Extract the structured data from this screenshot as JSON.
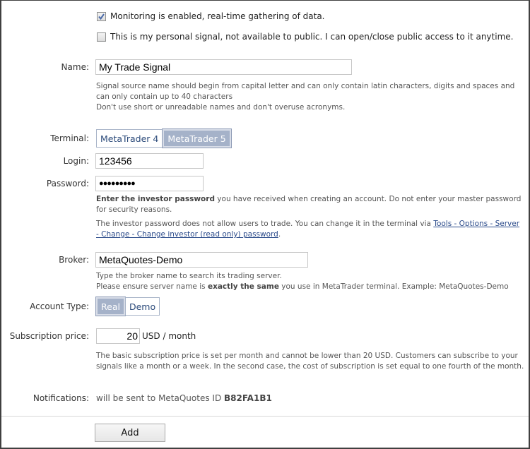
{
  "checkboxes": [
    {
      "label": "Monitoring is enabled, real-time gathering of data.",
      "checked": true
    },
    {
      "label": "This is my personal signal, not available to public. I can open/close public access to it anytime.",
      "checked": false
    }
  ],
  "name": {
    "label": "Name:",
    "value": "My Trade Signal",
    "hint_line1": "Signal source name should begin from capital letter and can only contain latin characters, digits and spaces and can only contain up to 40 characters",
    "hint_line2": "Don't use short or unreadable names and don't overuse acronyms."
  },
  "terminal": {
    "label": "Terminal:",
    "options": [
      "MetaTrader 4",
      "MetaTrader 5"
    ],
    "selected": "MetaTrader 5"
  },
  "login": {
    "label": "Login:",
    "value": "123456"
  },
  "password": {
    "label": "Password:",
    "masked_value": "●●●●●●●●●",
    "hint_bold": "Enter the investor password",
    "hint_rest": " you have received when creating an account. Do not enter your master password for security reasons.",
    "hint2_prefix": "The investor password does not allow users to trade. You can change it in the terminal via ",
    "hint2_link": "Tools - Options - Server - Change - Change investor (read only) password",
    "hint2_suffix": "."
  },
  "broker": {
    "label": "Broker:",
    "value": "MetaQuotes-Demo",
    "hint_line1": "Type the broker name to search its trading server.",
    "hint_line2_prefix": "Please ensure server name is ",
    "hint_line2_bold": "exactly the same",
    "hint_line2_suffix": " you use in MetaTrader terminal. Example: MetaQuotes-Demo"
  },
  "account_type": {
    "label": "Account Type:",
    "options": [
      "Real",
      "Demo"
    ],
    "selected": "Real"
  },
  "subscription": {
    "label": "Subscription price:",
    "value": "20",
    "unit": "USD / month",
    "hint": "The basic subscription price is set per month and cannot be lower than 20 USD. Customers can subscribe to your signals like a month or a week. In the second case, the cost of subscription is set equal to one fourth of the month."
  },
  "notifications": {
    "label": "Notifications:",
    "text": "will be sent to MetaQuotes ID ",
    "id": "B82FA1B1"
  },
  "add_button": "Add",
  "colors": {
    "toggle_active_bg": "#a5b2c9",
    "toggle_text": "#2b4a7a",
    "link": "#2a4a8a"
  }
}
